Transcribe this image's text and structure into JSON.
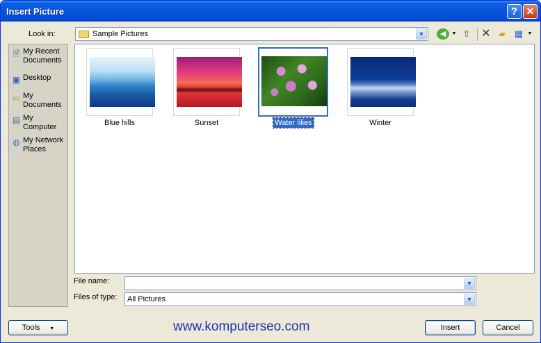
{
  "window": {
    "title": "Insert Picture"
  },
  "titlebar_buttons": {
    "help": "?",
    "close": "✕"
  },
  "lookin": {
    "label": "Look in:",
    "value": "Sample Pictures"
  },
  "toolbar": {
    "icons": [
      "back-icon",
      "up-folder-icon",
      "delete-icon",
      "new-folder-icon",
      "views-icon"
    ]
  },
  "places": [
    {
      "label": "My Recent Documents",
      "icon": "recent-documents-icon"
    },
    {
      "label": "Desktop",
      "icon": "desktop-icon"
    },
    {
      "label": "My Documents",
      "icon": "my-documents-icon"
    },
    {
      "label": "My Computer",
      "icon": "my-computer-icon"
    },
    {
      "label": "My Network Places",
      "icon": "network-places-icon"
    }
  ],
  "files": [
    {
      "name": "Blue hills",
      "selected": false
    },
    {
      "name": "Sunset",
      "selected": false
    },
    {
      "name": "Water lilies",
      "selected": true
    },
    {
      "name": "Winter",
      "selected": false
    }
  ],
  "filename": {
    "label": "File name:",
    "value": ""
  },
  "filetype": {
    "label": "Files of type:",
    "value": "All Pictures"
  },
  "buttons": {
    "tools": "Tools",
    "insert": "Insert",
    "cancel": "Cancel"
  },
  "watermark": "www.komputerseo.com"
}
